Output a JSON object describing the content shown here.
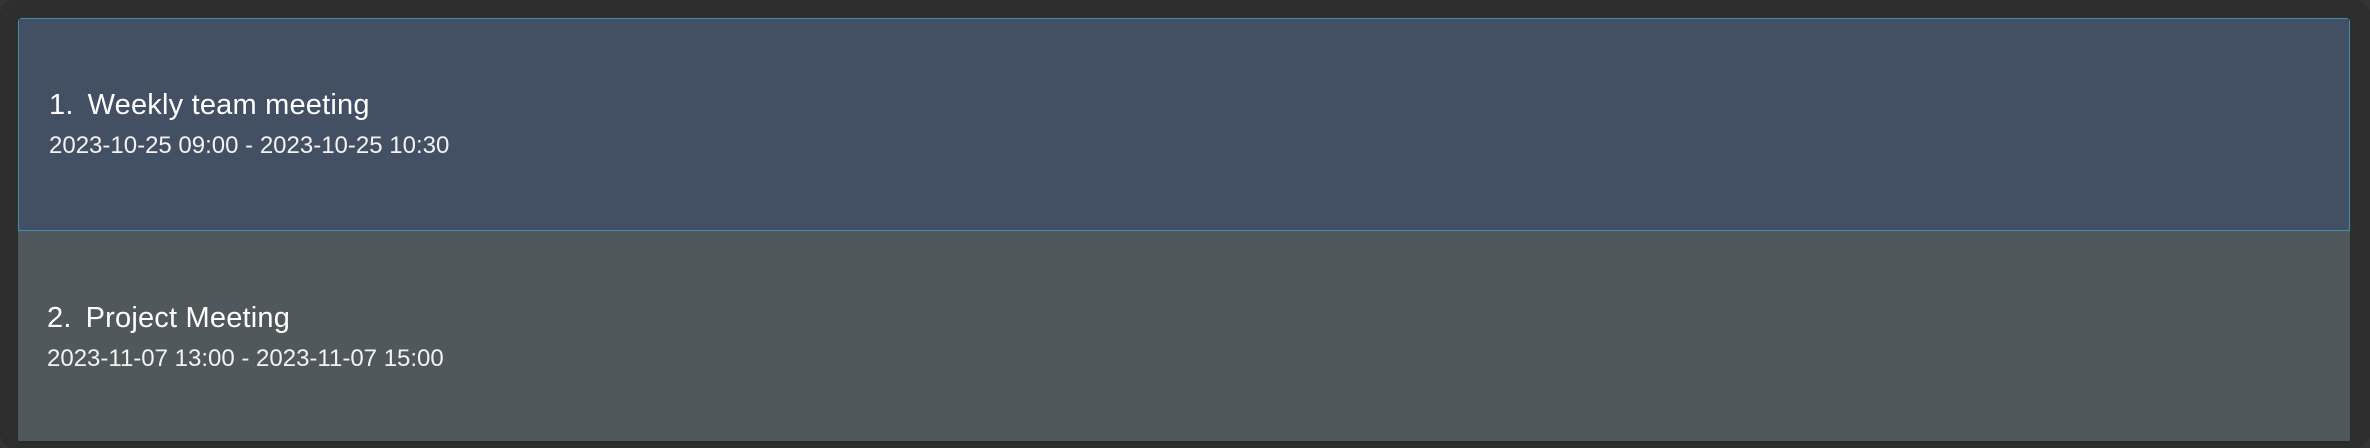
{
  "events": [
    {
      "index": "1.",
      "title": "Weekly team meeting",
      "time_range": "2023-10-25 09:00 - 2023-10-25 10:30",
      "selected": true
    },
    {
      "index": "2.",
      "title": "Project Meeting",
      "time_range": "2023-11-07 13:00 - 2023-11-07 15:00",
      "selected": false
    }
  ],
  "colors": {
    "selected_background": "#434f63",
    "selected_border": "#3d8fb0",
    "item_background": "#51585c",
    "text": "#ffffff"
  }
}
